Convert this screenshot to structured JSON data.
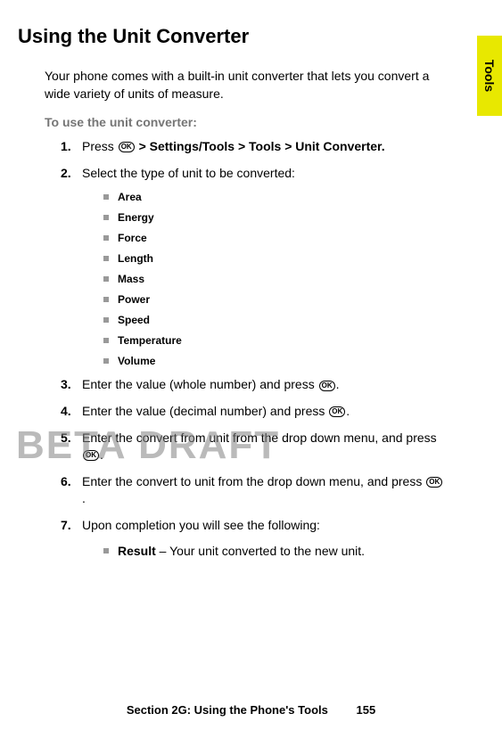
{
  "tab": {
    "label": "Tools"
  },
  "heading": "Using the Unit Converter",
  "intro": "Your phone comes with a built-in unit converter that lets you convert a wide variety of units of measure.",
  "subheading": "To use the unit converter:",
  "steps": {
    "s1": {
      "num": "1.",
      "prefix": "Press ",
      "bold": " > Settings/Tools > Tools > Unit Converter."
    },
    "s2": {
      "num": "2.",
      "text": "Select the type of unit to be converted:"
    },
    "s3": {
      "num": "3.",
      "text": "Enter the value (whole number) and press ",
      "suffix": "."
    },
    "s4": {
      "num": "4.",
      "text": "Enter the value (decimal number) and press ",
      "suffix": "."
    },
    "s5": {
      "num": "5.",
      "text": "Enter the convert from unit from the drop down menu, and press ",
      "suffix": "."
    },
    "s6": {
      "num": "6.",
      "text": "Enter the convert to unit from the drop down menu, and press ",
      "suffix": "."
    },
    "s7": {
      "num": "7.",
      "text": "Upon completion you will see the following:"
    }
  },
  "units": {
    "u0": "Area",
    "u1": "Energy",
    "u2": "Force",
    "u3": "Length",
    "u4": "Mass",
    "u5": "Power",
    "u6": "Speed",
    "u7": "Temperature",
    "u8": "Volume"
  },
  "result": {
    "label": "Result",
    "text": " – Your unit converted to the new unit."
  },
  "okLabel": "OK",
  "watermark": "BETA DRAFT",
  "footer": {
    "section": "Section 2G: Using the Phone's Tools",
    "page": "155"
  }
}
